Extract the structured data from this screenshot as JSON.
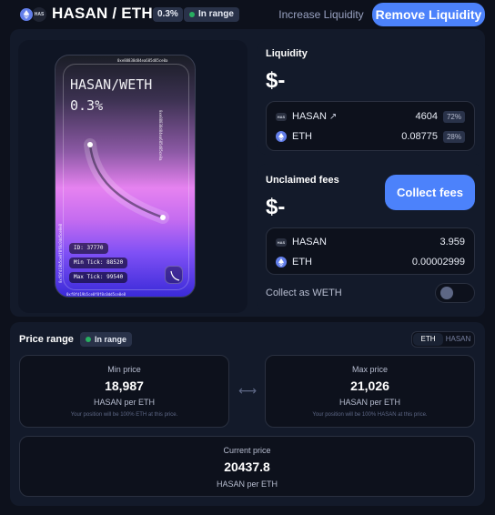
{
  "header": {
    "pair_title": "HASAN / ETH",
    "fee_tier": "0.3%",
    "range_status": "In range",
    "token0_icon_text": "HAS",
    "increase_label": "Increase Liquidity",
    "remove_label": "Remove Liquidity"
  },
  "nft": {
    "title": "HASAN/WETH",
    "fee": "0.3%",
    "id_tag": "ID: 37770",
    "min_tick_tag": "Min Tick: 88520",
    "max_tick_tag": "Max Tick: 99540",
    "edge_top": "0xe88838d84ea685d85ce0a",
    "edge_bottom": "0xf8fd19b5ce0f8f8c0dd5ce0e8"
  },
  "liquidity": {
    "label": "Liquidity",
    "value": "$-",
    "rows": [
      {
        "symbol": "HASAN",
        "icon": "hasan-token-icon",
        "amount": "4604",
        "percent": "72%"
      },
      {
        "symbol": "ETH",
        "icon": "eth-token-icon",
        "amount": "0.08775",
        "percent": "28%"
      }
    ]
  },
  "fees": {
    "label": "Unclaimed fees",
    "value": "$-",
    "collect_label": "Collect fees",
    "rows": [
      {
        "symbol": "HASAN",
        "amount": "3.959"
      },
      {
        "symbol": "ETH",
        "amount": "0.00002999"
      }
    ],
    "collect_as_weth_label": "Collect as WETH",
    "collect_as_weth": false
  },
  "price_range": {
    "title": "Price range",
    "status": "In range",
    "unit_options": [
      "ETH",
      "HASAN"
    ],
    "unit_selected": "ETH",
    "min": {
      "label": "Min price",
      "value": "18,987",
      "unit": "HASAN per ETH",
      "note": "Your position will be 100% ETH at this price."
    },
    "max": {
      "label": "Max price",
      "value": "21,026",
      "unit": "HASAN per ETH",
      "note": "Your position will be 100% HASAN at this price."
    },
    "current": {
      "label": "Current price",
      "value": "20437.8",
      "unit": "HASAN per ETH"
    }
  },
  "colors": {
    "accent": "#4c82fb",
    "background": "#0d111c",
    "panel": "#131a2a",
    "in_range": "#27ae60",
    "eth": "#627eea"
  }
}
